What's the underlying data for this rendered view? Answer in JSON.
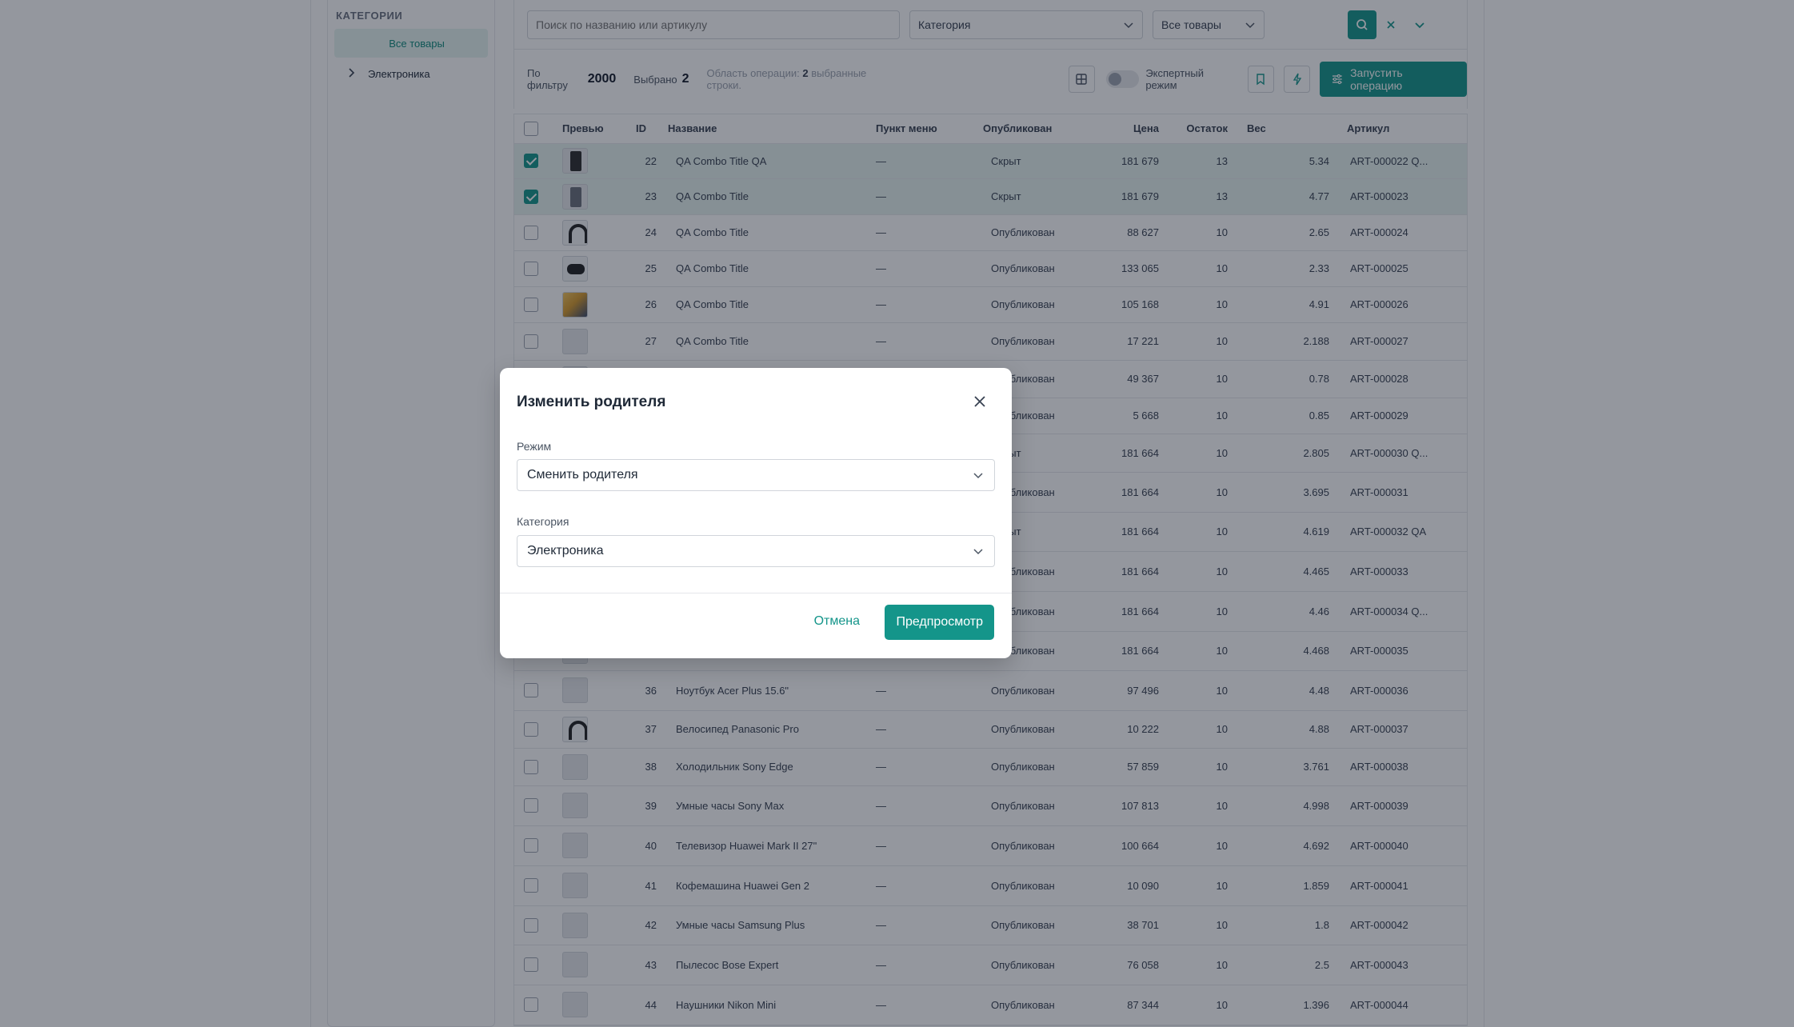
{
  "sidebar": {
    "title": "КАТЕГОРИИ",
    "items": [
      {
        "label": "Все товары"
      },
      {
        "label": "Электроника"
      }
    ]
  },
  "filters": {
    "search_placeholder": "Поиск по названию или артикулу",
    "category_placeholder": "Категория",
    "scope_value": "Все товары"
  },
  "stats": {
    "filtered_label": "По фильтру",
    "filtered_value": "2000",
    "selected_label": "Выбрано",
    "selected_value": "2",
    "scope_label": "Область операции:",
    "scope_count": "2",
    "scope_suffix": "выбранные строки.",
    "expert_mode_label": "Экспертный режим",
    "run_label": "Запустить операцию"
  },
  "table": {
    "columns": [
      "Превью",
      "ID",
      "Название",
      "Пункт меню",
      "Опубликован",
      "Цена",
      "Остаток",
      "Вес",
      "Артикул"
    ],
    "rows": [
      {
        "checked": true,
        "thumb": "phone",
        "id": "22",
        "name": "QA Combo Title QA",
        "menu": "—",
        "pub": "Скрыт",
        "price": "181 679",
        "stock": "13",
        "weight": "5.34",
        "art": "ART-000022 Q..."
      },
      {
        "checked": true,
        "thumb": "phone2",
        "id": "23",
        "name": "QA Combo Title",
        "menu": "—",
        "pub": "Скрыт",
        "price": "181 679",
        "stock": "13",
        "weight": "4.77",
        "art": "ART-000023"
      },
      {
        "checked": false,
        "thumb": "headphones",
        "id": "24",
        "name": "QA Combo Title",
        "menu": "—",
        "pub": "Опубликован",
        "price": "88 627",
        "stock": "10",
        "weight": "2.65",
        "art": "ART-000024"
      },
      {
        "checked": false,
        "thumb": "gamepad",
        "id": "25",
        "name": "QA Combo Title",
        "menu": "—",
        "pub": "Опубликован",
        "price": "133 065",
        "stock": "10",
        "weight": "2.33",
        "art": "ART-000025"
      },
      {
        "checked": false,
        "thumb": "photo",
        "id": "26",
        "name": "QA Combo Title",
        "menu": "—",
        "pub": "Опубликован",
        "price": "105 168",
        "stock": "10",
        "weight": "4.91",
        "art": "ART-000026"
      },
      {
        "checked": false,
        "thumb": "blank",
        "id": "27",
        "name": "QA Combo Title",
        "menu": "—",
        "pub": "Опубликован",
        "price": "17 221",
        "stock": "10",
        "weight": "2.188",
        "art": "ART-000027"
      },
      {
        "checked": false,
        "thumb": "blank",
        "id": "",
        "name": "",
        "menu": "",
        "pub": "Опубликован",
        "price": "49 367",
        "stock": "10",
        "weight": "0.78",
        "art": "ART-000028"
      },
      {
        "checked": false,
        "thumb": "blank",
        "id": "",
        "name": "",
        "menu": "",
        "pub": "Опубликован",
        "price": "5 668",
        "stock": "10",
        "weight": "0.85",
        "art": "ART-000029"
      },
      {
        "checked": false,
        "thumb": "blank",
        "id": "",
        "name": "",
        "menu": "",
        "pub": "Скрыт",
        "price": "181 664",
        "stock": "10",
        "weight": "2.805",
        "art": "ART-000030 Q..."
      },
      {
        "checked": false,
        "thumb": "blank",
        "id": "",
        "name": "",
        "menu": "",
        "pub": "Опубликован",
        "price": "181 664",
        "stock": "10",
        "weight": "3.695",
        "art": "ART-000031"
      },
      {
        "checked": false,
        "thumb": "blank",
        "id": "",
        "name": "",
        "menu": "",
        "pub": "Скрыт",
        "price": "181 664",
        "stock": "10",
        "weight": "4.619",
        "art": "ART-000032 QA"
      },
      {
        "checked": false,
        "thumb": "blank",
        "id": "",
        "name": "",
        "menu": "",
        "pub": "Опубликован",
        "price": "181 664",
        "stock": "10",
        "weight": "4.465",
        "art": "ART-000033"
      },
      {
        "checked": false,
        "thumb": "blank",
        "id": "",
        "name": "",
        "menu": "",
        "pub": "Опубликован",
        "price": "181 664",
        "stock": "10",
        "weight": "4.46",
        "art": "ART-000034 Q..."
      },
      {
        "checked": false,
        "thumb": "blank",
        "id": "",
        "name": "",
        "menu": "",
        "pub": "Опубликован",
        "price": "181 664",
        "stock": "10",
        "weight": "4.468",
        "art": "ART-000035"
      },
      {
        "checked": false,
        "thumb": "blank",
        "id": "36",
        "name": "Ноутбук Acer Plus 15.6\"",
        "menu": "—",
        "pub": "Опубликован",
        "price": "97 496",
        "stock": "10",
        "weight": "4.48",
        "art": "ART-000036"
      },
      {
        "checked": false,
        "thumb": "headphones",
        "id": "37",
        "name": "Велосипед Panasonic Pro",
        "menu": "—",
        "pub": "Опубликован",
        "price": "10 222",
        "stock": "10",
        "weight": "4.88",
        "art": "ART-000037"
      },
      {
        "checked": false,
        "thumb": "blank",
        "id": "38",
        "name": "Холодильник Sony Edge",
        "menu": "—",
        "pub": "Опубликован",
        "price": "57 859",
        "stock": "10",
        "weight": "3.761",
        "art": "ART-000038"
      },
      {
        "checked": false,
        "thumb": "blank",
        "id": "39",
        "name": "Умные часы Sony Max",
        "menu": "—",
        "pub": "Опубликован",
        "price": "107 813",
        "stock": "10",
        "weight": "4.998",
        "art": "ART-000039"
      },
      {
        "checked": false,
        "thumb": "blank",
        "id": "40",
        "name": "Телевизор Huawei Mark II 27\"",
        "menu": "—",
        "pub": "Опубликован",
        "price": "100 664",
        "stock": "10",
        "weight": "4.692",
        "art": "ART-000040"
      },
      {
        "checked": false,
        "thumb": "blank",
        "id": "41",
        "name": "Кофемашина Huawei Gen 2",
        "menu": "—",
        "pub": "Опубликован",
        "price": "10 090",
        "stock": "10",
        "weight": "1.859",
        "art": "ART-000041"
      },
      {
        "checked": false,
        "thumb": "blank",
        "id": "42",
        "name": "Умные часы Samsung Plus",
        "menu": "—",
        "pub": "Опубликован",
        "price": "38 701",
        "stock": "10",
        "weight": "1.8",
        "art": "ART-000042"
      },
      {
        "checked": false,
        "thumb": "blank",
        "id": "43",
        "name": "Пылесос Bose Expert",
        "menu": "—",
        "pub": "Опубликован",
        "price": "76 058",
        "stock": "10",
        "weight": "2.5",
        "art": "ART-000043"
      },
      {
        "checked": false,
        "thumb": "blank",
        "id": "44",
        "name": "Наушники Nikon Mini",
        "menu": "—",
        "pub": "Опубликован",
        "price": "87 344",
        "stock": "10",
        "weight": "1.396",
        "art": "ART-000044"
      }
    ]
  },
  "modal": {
    "title": "Изменить родителя",
    "mode_label": "Режим",
    "mode_value": "Сменить родителя",
    "category_label": "Категория",
    "category_value": "Электроника",
    "cancel_label": "Отмена",
    "preview_label": "Предпросмотр"
  },
  "colors": {
    "accent": "#14958a",
    "selected_row": "#e6f2ef",
    "overlay": "rgba(17,24,39,0.45)"
  }
}
